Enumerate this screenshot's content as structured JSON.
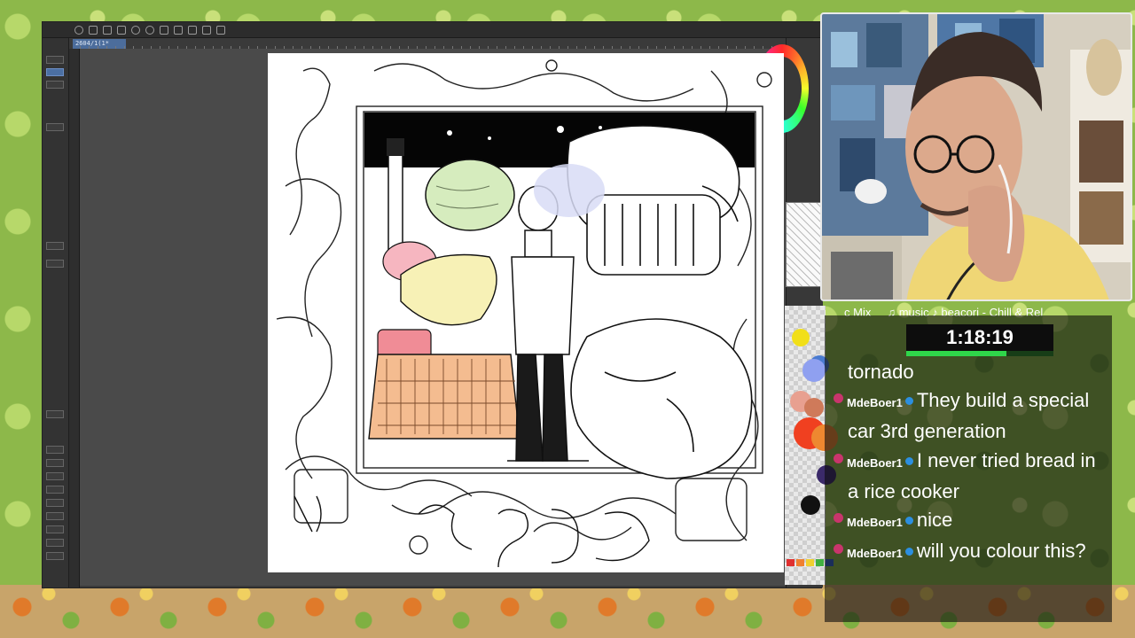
{
  "app": {
    "document_tab": "2604/1(1*",
    "swatch_colors": [
      "#f1df18",
      "#4a7bd0",
      "#8fa0f0",
      "#e8a090",
      "#cf7a5a",
      "#f04020",
      "#ee8830",
      "#3b2a6a",
      "#111111"
    ],
    "palette_colors": [
      "#e03030",
      "#f08030",
      "#f0d030",
      "#40b040",
      "#3060d0"
    ]
  },
  "overlay": {
    "stream_label": "c Mix",
    "now_playing": "♫ music ♪ beacori - Chill & Rel",
    "timer": "1:18:19",
    "timer_progress": 0.68
  },
  "chat": {
    "messages": [
      {
        "user": "",
        "text": "tornado"
      },
      {
        "user": "MdeBoer1",
        "text": "They build a special car 3rd generation"
      },
      {
        "user": "MdeBoer1",
        "text": "I never tried bread in a rice cooker"
      },
      {
        "user": "MdeBoer1",
        "text": "nice"
      },
      {
        "user": "MdeBoer1",
        "text": "will you colour this?"
      }
    ]
  }
}
